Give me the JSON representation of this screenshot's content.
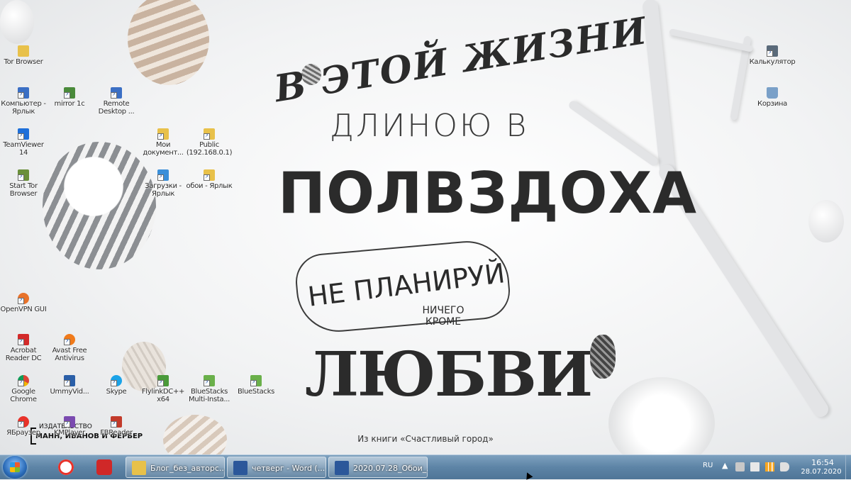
{
  "wallpaper": {
    "line1": "В ЭТОЙ ЖИЗНИ",
    "line2": "ДЛИНОЮ В",
    "line3": "ПОЛВЗДОХА",
    "line4": "НЕ ПЛАНИРУЙ",
    "line5": "НИЧЕГО КРОМЕ",
    "line6": "ЛЮБВИ",
    "caption": "Из книги «Счастливый город»",
    "publisher_line1": "ИЗДАТЕЛЬСТВО",
    "publisher_line2": "МАНН, ИВАНОВ И ФЕРБЕР"
  },
  "desktop_icons": [
    {
      "id": "tor-browser",
      "label": "Tor Browser",
      "icon": "folder-icon",
      "color": "#e8c14a"
    },
    {
      "id": "computer",
      "label": "Компьютер - Ярлык",
      "icon": "computer-icon",
      "color": "#3b6fc4"
    },
    {
      "id": "mirror-1c",
      "label": "mirror 1c",
      "icon": "shortcut-icon",
      "color": "#4a8a3a"
    },
    {
      "id": "remote-desktop",
      "label": "Remote Desktop ...",
      "icon": "remote-desktop-icon",
      "color": "#3b6fc4"
    },
    {
      "id": "teamviewer",
      "label": "TeamViewer 14",
      "icon": "teamviewer-icon",
      "color": "#1e6fd9"
    },
    {
      "id": "my-documents",
      "label": "Мои документ...",
      "icon": "documents-icon",
      "color": "#e8c14a"
    },
    {
      "id": "public",
      "label": "Public (192.168.0.1)",
      "icon": "network-folder-icon",
      "color": "#e8c14a"
    },
    {
      "id": "start-tor",
      "label": "Start Tor Browser",
      "icon": "tor-icon",
      "color": "#6a8f3a"
    },
    {
      "id": "downloads",
      "label": "Загрузки - Ярлык",
      "icon": "downloads-icon",
      "color": "#3b8fd9"
    },
    {
      "id": "wallpapers",
      "label": "обои - Ярлык",
      "icon": "folder-icon",
      "color": "#e8c14a"
    },
    {
      "id": "openvpn",
      "label": "OpenVPN GUI",
      "icon": "openvpn-icon",
      "color": "#e8722a"
    },
    {
      "id": "acrobat",
      "label": "Acrobat Reader DC",
      "icon": "acrobat-icon",
      "color": "#d32a2a"
    },
    {
      "id": "avast",
      "label": "Avast Free Antivirus",
      "icon": "avast-icon",
      "color": "#f07a1a"
    },
    {
      "id": "chrome",
      "label": "Google Chrome",
      "icon": "chrome-icon",
      "color": "#3aa757"
    },
    {
      "id": "ummyvideo",
      "label": "UmmyVid...",
      "icon": "ummy-icon",
      "color": "#2a5fa8"
    },
    {
      "id": "skype",
      "label": "Skype",
      "icon": "skype-icon",
      "color": "#1aa3e8"
    },
    {
      "id": "flylinkdc",
      "label": "FlylinkDC++ x64",
      "icon": "flylink-icon",
      "color": "#4a9a3a"
    },
    {
      "id": "bluestacks-multi",
      "label": "BlueStacks Multi-Insta...",
      "icon": "bluestacks-icon",
      "color": "#6ab04a"
    },
    {
      "id": "bluestacks",
      "label": "BlueStacks",
      "icon": "bluestacks-icon",
      "color": "#6ab04a"
    },
    {
      "id": "yandex-browser",
      "label": "ЯБраузер",
      "icon": "yandex-browser-icon",
      "color": "#e8322a"
    },
    {
      "id": "kmplayer",
      "label": "KMPlayer",
      "icon": "kmplayer-icon",
      "color": "#7a4ab0"
    },
    {
      "id": "fbreader",
      "label": "FBReader",
      "icon": "fbreader-icon",
      "color": "#c23a2a"
    },
    {
      "id": "calculator",
      "label": "Калькулятор",
      "icon": "calculator-icon",
      "color": "#5a6a7a"
    },
    {
      "id": "recycle-bin",
      "label": "Корзина",
      "icon": "recycle-bin-icon",
      "color": "#7aa0c8"
    }
  ],
  "taskbar": {
    "pinned": [
      {
        "id": "yandex",
        "icon": "yandex-icon",
        "color": "#e8322a"
      },
      {
        "id": "downloader",
        "icon": "download-arrow-icon",
        "color": "#d02828"
      }
    ],
    "tasks": [
      {
        "id": "explorer",
        "label": "Блог_без_авторс...",
        "icon": "folder-icon",
        "color": "#e8c14a"
      },
      {
        "id": "word1",
        "label": "четверг - Word (...",
        "icon": "word-icon",
        "color": "#2b579a"
      },
      {
        "id": "word2",
        "label": "2020.07.28_Обои_...",
        "icon": "word-icon",
        "color": "#2b579a"
      }
    ],
    "tray": {
      "language": "RU",
      "chevron": "▲",
      "time": "16:54",
      "date": "28.07.2020"
    }
  }
}
